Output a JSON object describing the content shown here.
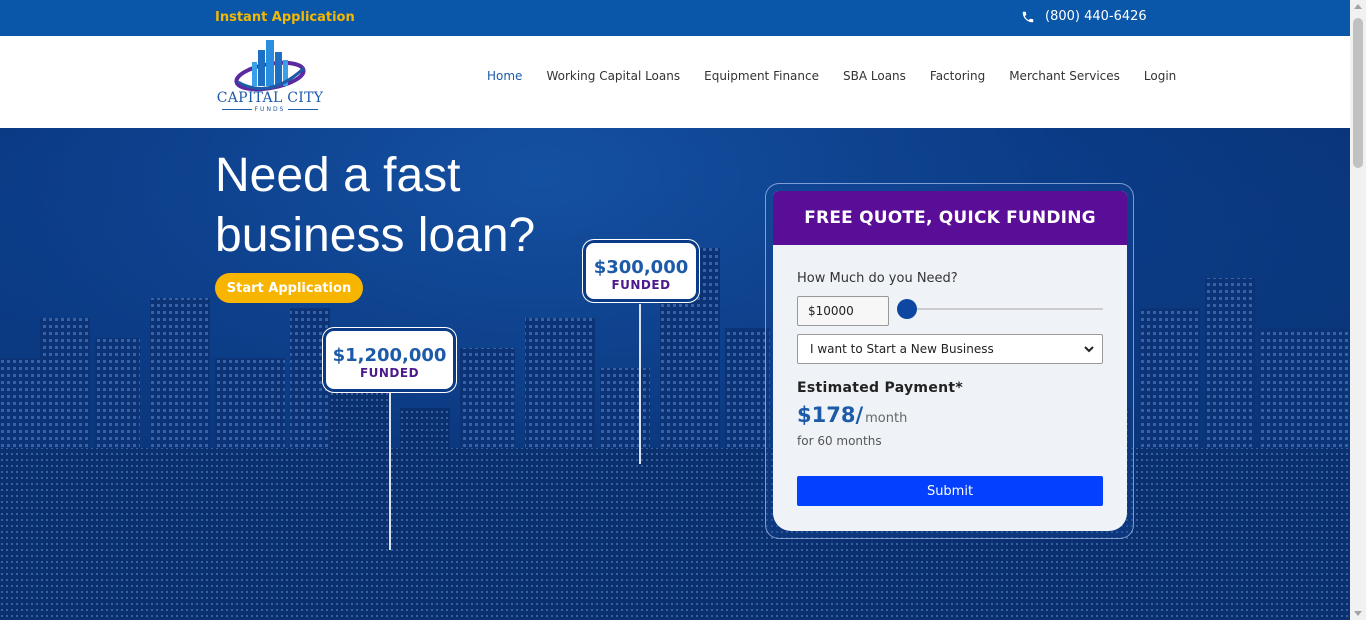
{
  "topbar": {
    "instant_label": "Instant Application",
    "phone": "(800) 440-6426",
    "phone_icon": "phone-icon"
  },
  "logo": {
    "name": "CAPITAL CITY",
    "sub": "FUNDS"
  },
  "nav": {
    "items": [
      {
        "label": "Home",
        "active": true
      },
      {
        "label": "Working Capital Loans"
      },
      {
        "label": "Equipment Finance"
      },
      {
        "label": "SBA Loans"
      },
      {
        "label": "Factoring"
      },
      {
        "label": "Merchant Services"
      },
      {
        "label": "Login"
      }
    ]
  },
  "hero": {
    "headline_line1": "Need a fast",
    "headline_line2": "business loan?",
    "cta_label": "Start Application",
    "funded": [
      {
        "amount": "$300,000",
        "label": "FUNDED"
      },
      {
        "amount": "$1,200,000",
        "label": "FUNDED"
      }
    ]
  },
  "quote": {
    "title": "FREE QUOTE, QUICK FUNDING",
    "amount_label": "How Much do you Need?",
    "amount_value": "$10000",
    "slider_level": 0,
    "select_value": "I want to Start a New Business",
    "estimate_title": "Estimated Payment*",
    "estimate_amount": "$178/",
    "estimate_per": "month",
    "estimate_term": "for 60 months",
    "submit_label": "Submit"
  },
  "colors": {
    "topbar": "#0a56a8",
    "accent_yellow": "#f8b500",
    "quote_header": "#5a0d96",
    "submit": "#0440ff",
    "brand_blue": "#1d5aa8"
  }
}
